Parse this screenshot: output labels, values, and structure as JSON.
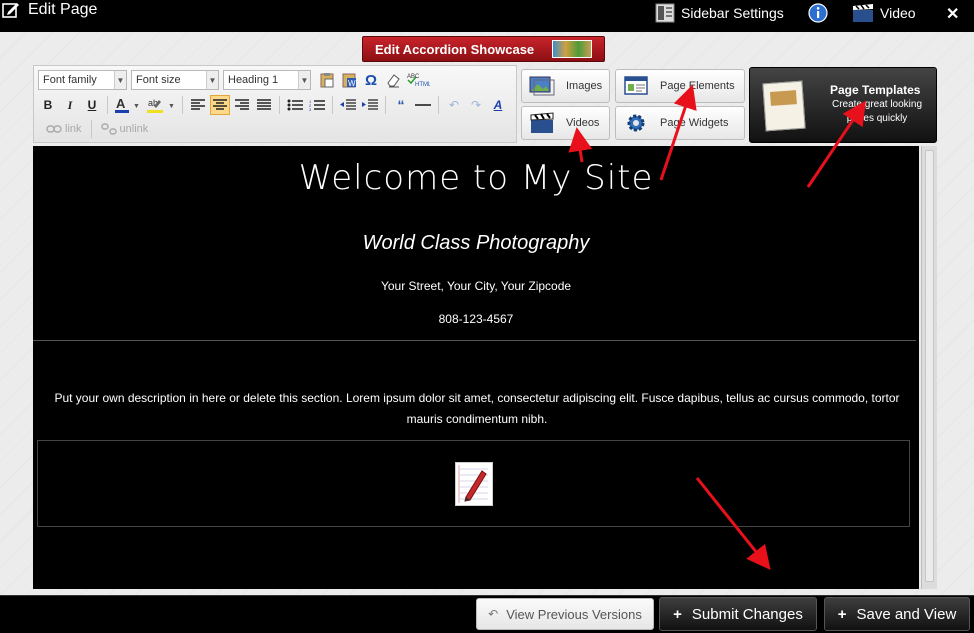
{
  "window": {
    "title": "Edit Page",
    "sidebar_settings_label": "Sidebar Settings",
    "video_label": "Video",
    "close_glyph": "✕"
  },
  "showcase": {
    "label": "Edit Accordion Showcase"
  },
  "toolbar": {
    "font_family": "Font family",
    "font_size": "Font size",
    "heading": "Heading 1",
    "bold": "B",
    "italic": "I",
    "underline": "U",
    "link_label": "link",
    "unlink_label": "unlink"
  },
  "media": {
    "images": "Images",
    "videos": "Videos",
    "page_elements": "Page Elements",
    "page_widgets": "Page Widgets",
    "templates_title": "Page Templates",
    "templates_desc": "Create great looking pages quickly"
  },
  "content": {
    "heading": "Welcome to My Site",
    "subheading": "World Class Photography",
    "address": "Your Street, Your City, Your Zipcode",
    "phone": "808-123-4567",
    "description": "Put your own description in here or delete this section. Lorem ipsum dolor sit amet, consectetur adipiscing elit. Fusce dapibus, tellus ac cursus commodo, tortor mauris condimentum nibh."
  },
  "footer": {
    "previous_versions": "View Previous Versions",
    "submit": "Submit Changes",
    "save_view": "Save and View"
  },
  "colors": {
    "accent_red": "#c8242a",
    "annotation_arrow": "#e8101a",
    "active_button": "#fbd88a"
  }
}
